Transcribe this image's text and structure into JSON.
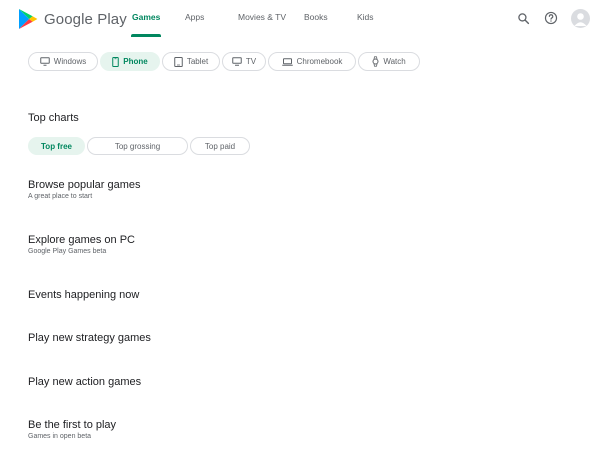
{
  "header": {
    "logo_text": "Google Play",
    "nav": [
      {
        "label": "Games",
        "active": true
      },
      {
        "label": "Apps",
        "active": false
      },
      {
        "label": "Movies & TV",
        "active": false
      },
      {
        "label": "Books",
        "active": false
      },
      {
        "label": "Kids",
        "active": false
      }
    ],
    "icons": [
      "search-icon",
      "help-icon",
      "account-icon"
    ],
    "accent_color": "#01875f"
  },
  "devices": [
    {
      "label": "Windows",
      "icon": "windows-monitor-icon",
      "selected": false
    },
    {
      "label": "Phone",
      "icon": "phone-icon",
      "selected": true
    },
    {
      "label": "Tablet",
      "icon": "tablet-icon",
      "selected": false
    },
    {
      "label": "TV",
      "icon": "tv-icon",
      "selected": false
    },
    {
      "label": "Chromebook",
      "icon": "laptop-icon",
      "selected": false
    },
    {
      "label": "Watch",
      "icon": "watch-icon",
      "selected": false
    }
  ],
  "top_charts": {
    "title": "Top charts",
    "tabs": [
      {
        "label": "Top free",
        "selected": true
      },
      {
        "label": "Top grossing",
        "selected": false
      },
      {
        "label": "Top paid",
        "selected": false
      }
    ]
  },
  "clusters": [
    {
      "title": "Browse popular games",
      "subtitle": "A great place to start"
    },
    {
      "title": "Explore games on PC",
      "subtitle": "Google Play Games beta"
    },
    {
      "title": "Events happening now",
      "subtitle": ""
    },
    {
      "title": "Play new strategy games",
      "subtitle": ""
    },
    {
      "title": "Play new action games",
      "subtitle": ""
    },
    {
      "title": "Be the first to play",
      "subtitle": "Games in open beta"
    }
  ]
}
